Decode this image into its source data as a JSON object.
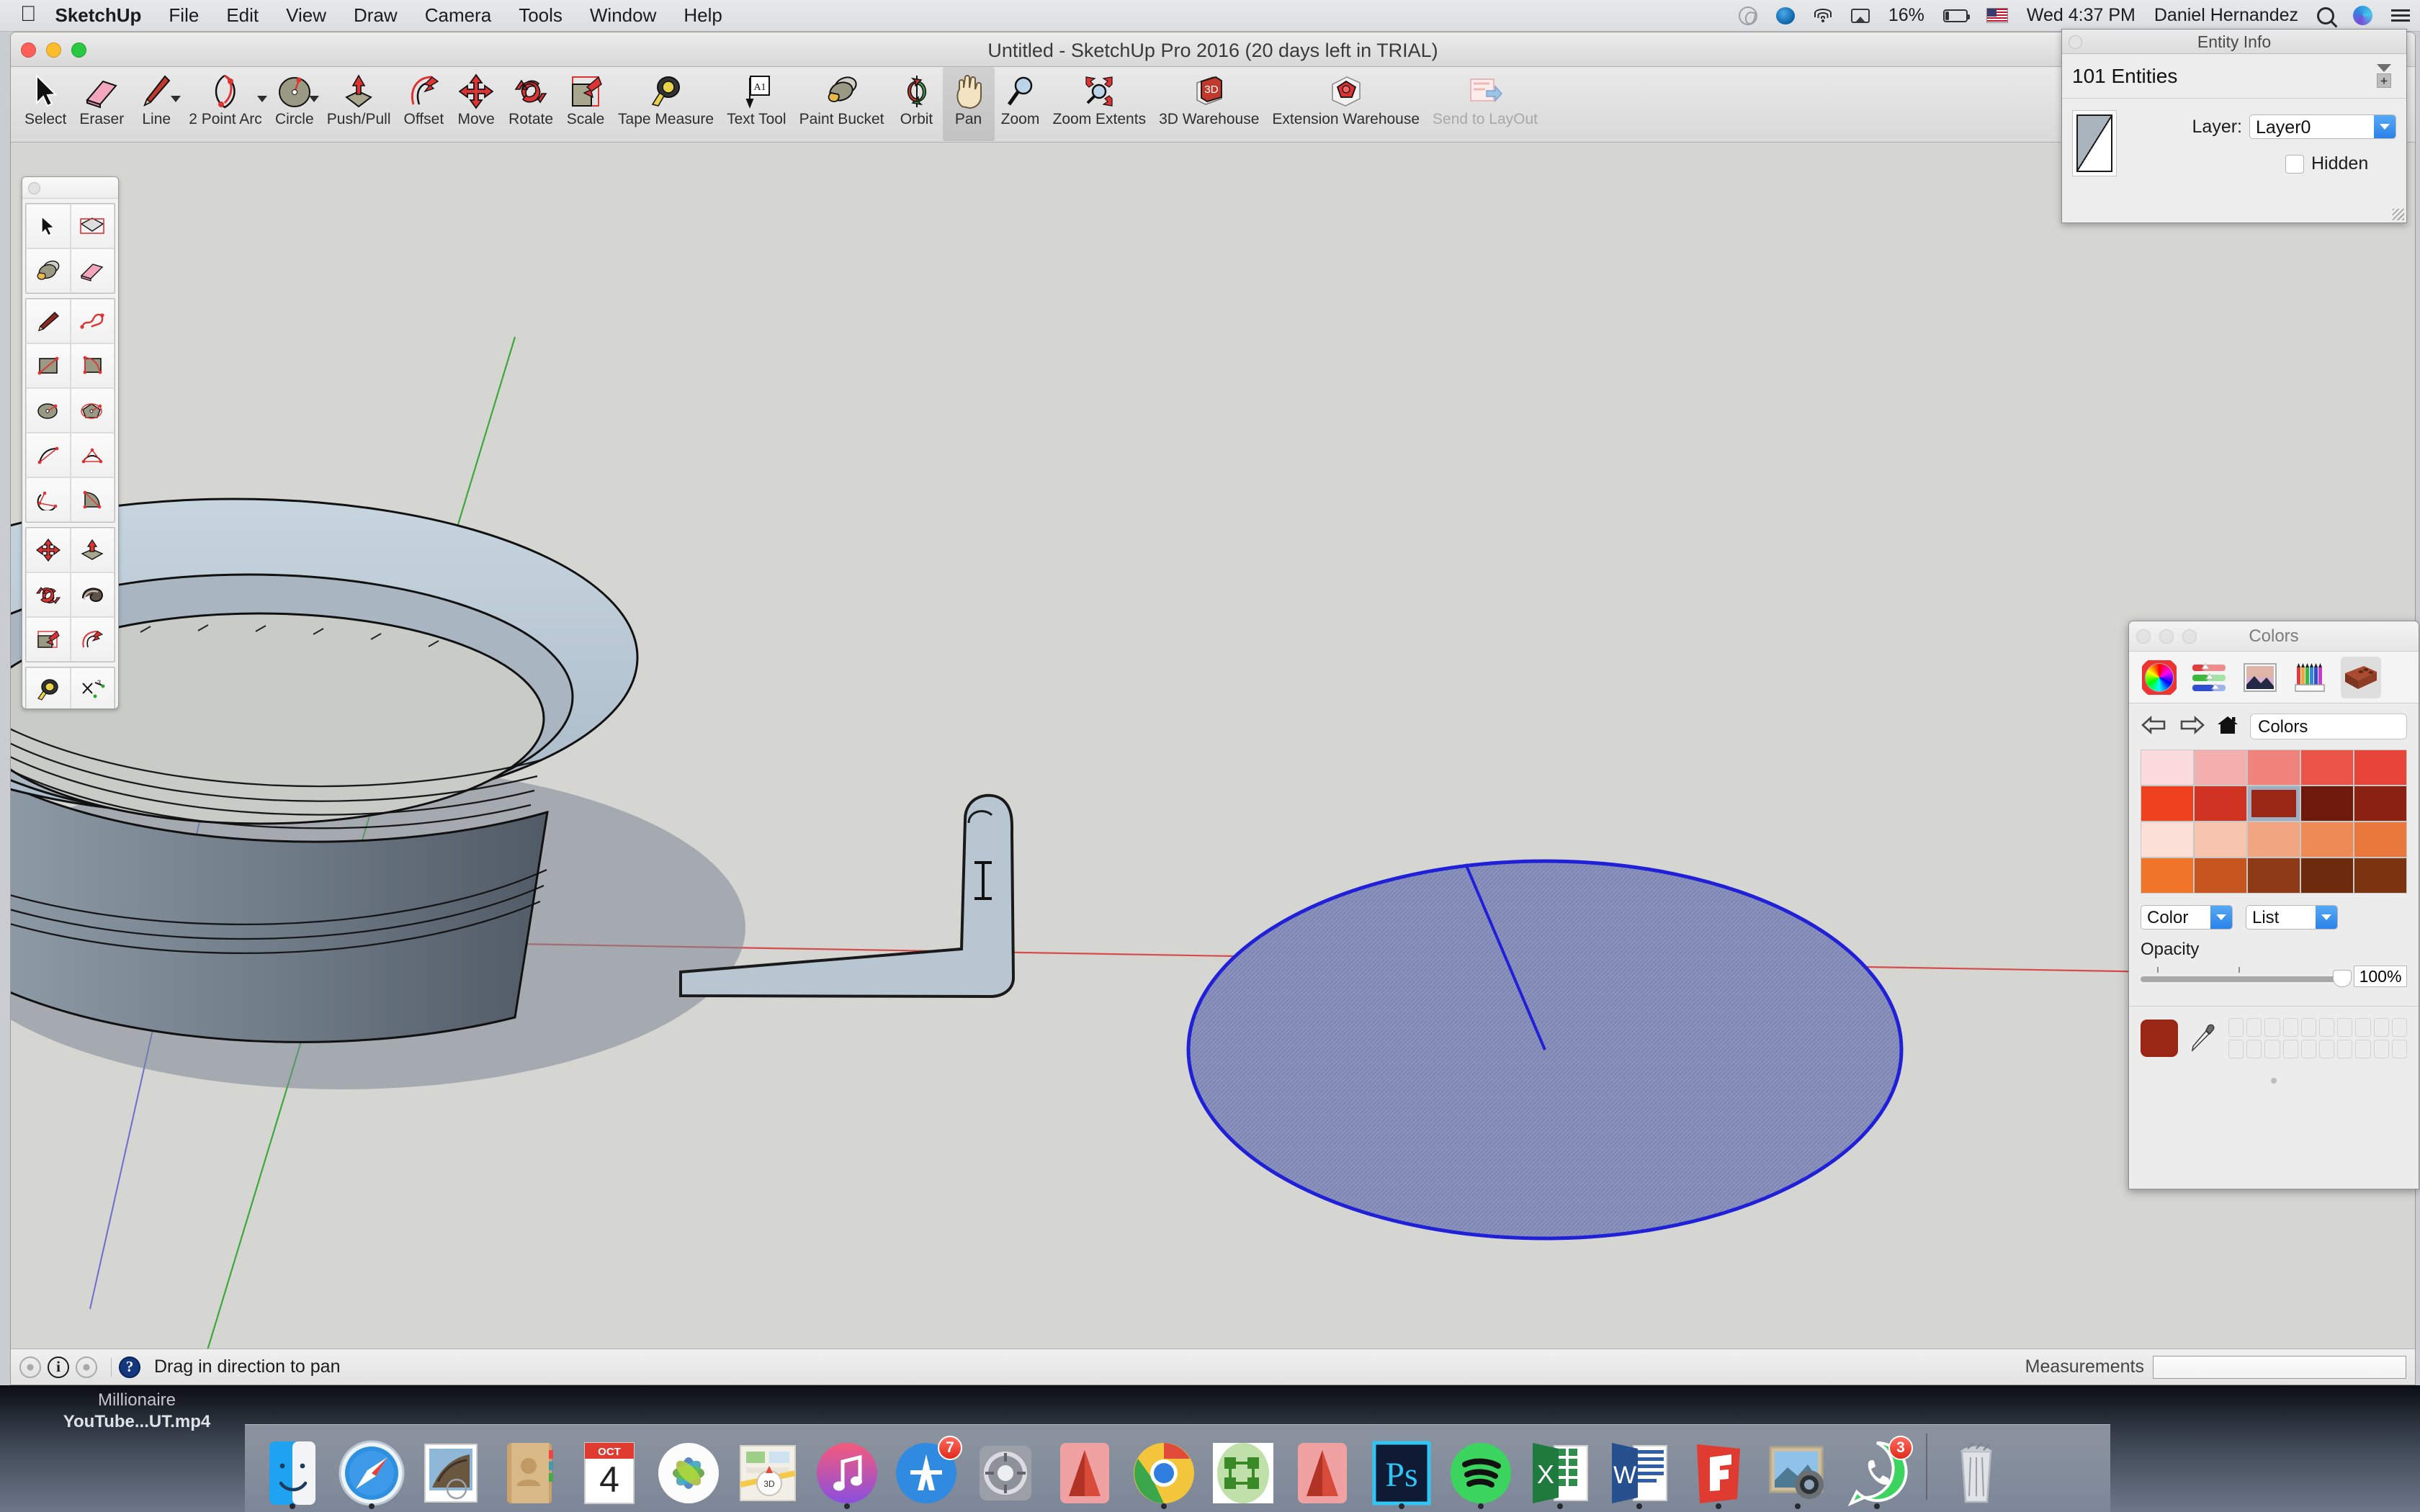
{
  "menubar": {
    "apple_icon": "apple-logo-icon",
    "items": [
      {
        "label": "SketchUp",
        "bold": true
      },
      {
        "label": "File",
        "bold": false
      },
      {
        "label": "Edit",
        "bold": false
      },
      {
        "label": "View",
        "bold": false
      },
      {
        "label": "Draw",
        "bold": false
      },
      {
        "label": "Camera",
        "bold": false
      },
      {
        "label": "Tools",
        "bold": false
      },
      {
        "label": "Window",
        "bold": false
      },
      {
        "label": "Help",
        "bold": false
      }
    ],
    "status": {
      "creative_cloud_icon": "creative-cloud-icon",
      "dropbox_icon": "dropbox-icon",
      "wifi_icon": "wifi-icon",
      "airplay_icon": "airplay-icon",
      "battery_percent": "16%",
      "battery_icon": "battery-icon",
      "flag_icon": "us-flag-icon",
      "clock": "Wed 4:37 PM",
      "user": "Daniel Hernandez",
      "search_icon": "spotlight-search-icon",
      "siri_icon": "siri-icon",
      "notification_icon": "notification-center-icon"
    }
  },
  "window": {
    "title": "Untitled - SketchUp Pro 2016 (20 days left in TRIAL)",
    "close_button": "close-button",
    "minimize_button": "minimize-button",
    "zoom_button": "zoom-button"
  },
  "toolbar": {
    "tools": [
      {
        "label": "Select",
        "icon": "arrow-cursor-icon",
        "active": false,
        "caret": false,
        "disabled": false
      },
      {
        "label": "Eraser",
        "icon": "eraser-icon",
        "active": false,
        "caret": false,
        "disabled": false
      },
      {
        "label": "Line",
        "icon": "pencil-line-icon",
        "active": false,
        "caret": true,
        "disabled": false
      },
      {
        "label": "2 Point Arc",
        "icon": "two-point-arc-icon",
        "active": false,
        "caret": true,
        "disabled": false
      },
      {
        "label": "Circle",
        "icon": "circle-icon",
        "active": false,
        "caret": true,
        "disabled": false
      },
      {
        "label": "Push/Pull",
        "icon": "push-pull-icon",
        "active": false,
        "caret": false,
        "disabled": false
      },
      {
        "label": "Offset",
        "icon": "offset-icon",
        "active": false,
        "caret": false,
        "disabled": false
      },
      {
        "label": "Move",
        "icon": "move-icon",
        "active": false,
        "caret": false,
        "disabled": false
      },
      {
        "label": "Rotate",
        "icon": "rotate-icon",
        "active": false,
        "caret": false,
        "disabled": false
      },
      {
        "label": "Scale",
        "icon": "scale-icon",
        "active": false,
        "caret": false,
        "disabled": false
      },
      {
        "label": "Tape Measure",
        "icon": "tape-measure-icon",
        "active": false,
        "caret": false,
        "disabled": false
      },
      {
        "label": "Text Tool",
        "icon": "text-tool-icon",
        "active": false,
        "caret": false,
        "disabled": false
      },
      {
        "label": "Paint Bucket",
        "icon": "paint-bucket-icon",
        "active": false,
        "caret": false,
        "disabled": false
      },
      {
        "label": "Orbit",
        "icon": "orbit-icon",
        "active": false,
        "caret": false,
        "disabled": false
      },
      {
        "label": "Pan",
        "icon": "pan-hand-icon",
        "active": true,
        "caret": false,
        "disabled": false
      },
      {
        "label": "Zoom",
        "icon": "zoom-magnifier-icon",
        "active": false,
        "caret": false,
        "disabled": false
      },
      {
        "label": "Zoom Extents",
        "icon": "zoom-extents-icon",
        "active": false,
        "caret": false,
        "disabled": false
      },
      {
        "label": "3D Warehouse",
        "icon": "3d-warehouse-icon",
        "active": false,
        "caret": false,
        "disabled": false
      },
      {
        "label": "Extension Warehouse",
        "icon": "extension-warehouse-icon",
        "active": false,
        "caret": false,
        "disabled": false
      },
      {
        "label": "Send to LayOut",
        "icon": "send-to-layout-icon",
        "active": false,
        "caret": false,
        "disabled": true
      }
    ]
  },
  "palette": {
    "groups": [
      {
        "cells": [
          {
            "icon": "select-arrow-icon",
            "active": false
          },
          {
            "icon": "select-box-icon",
            "active": false
          },
          {
            "icon": "paint-bucket-icon",
            "active": false
          },
          {
            "icon": "eraser-icon",
            "active": false
          }
        ]
      },
      {
        "cells": [
          {
            "icon": "line-pencil-icon",
            "active": false
          },
          {
            "icon": "freehand-icon",
            "active": false
          },
          {
            "icon": "rectangle-icon",
            "active": false
          },
          {
            "icon": "rotated-rectangle-icon",
            "active": false
          },
          {
            "icon": "circle-icon",
            "active": false
          },
          {
            "icon": "polygon-icon",
            "active": false
          },
          {
            "icon": "arc-icon",
            "active": false
          },
          {
            "icon": "two-point-arc-icon",
            "active": false
          },
          {
            "icon": "three-point-arc-icon",
            "active": false
          },
          {
            "icon": "pie-icon",
            "active": false
          }
        ]
      },
      {
        "cells": [
          {
            "icon": "move-icon",
            "active": false
          },
          {
            "icon": "push-pull-icon",
            "active": false
          },
          {
            "icon": "rotate-icon",
            "active": false
          },
          {
            "icon": "follow-me-icon",
            "active": false
          },
          {
            "icon": "scale-icon",
            "active": false
          },
          {
            "icon": "offset-icon",
            "active": false
          }
        ]
      },
      {
        "cells": [
          {
            "icon": "tape-measure-icon",
            "active": false
          },
          {
            "icon": "dimension-icon",
            "active": false
          },
          {
            "icon": "protractor-icon",
            "active": false
          },
          {
            "icon": "text-tool-icon",
            "active": false
          },
          {
            "icon": "axes-icon",
            "active": false
          },
          {
            "icon": "3d-text-icon",
            "active": false
          }
        ]
      },
      {
        "cells": [
          {
            "icon": "orbit-icon",
            "active": false
          },
          {
            "icon": "pan-hand-icon",
            "active": true
          },
          {
            "icon": "zoom-magnifier-icon",
            "active": false
          },
          {
            "icon": "zoom-window-icon",
            "active": false
          },
          {
            "icon": "zoom-extents-icon",
            "active": false
          },
          {
            "icon": "previous-view-icon",
            "active": false
          }
        ]
      },
      {
        "cells": [
          {
            "icon": "position-camera-icon",
            "active": false
          },
          {
            "icon": "walk-icon",
            "active": false
          },
          {
            "icon": "look-around-icon",
            "active": false
          },
          {
            "icon": "section-plane-icon",
            "active": false
          }
        ]
      }
    ]
  },
  "entity_info": {
    "panel_title": "Entity Info",
    "count_label": "101 Entities",
    "expand_button": "expand-collapse-button",
    "thumbnail": "face-material-thumbnail",
    "layer_label": "Layer:",
    "layer_value": "Layer0",
    "hidden_label": "Hidden",
    "hidden_checked": false
  },
  "colors_panel": {
    "panel_title": "Colors",
    "tabs": [
      {
        "icon": "color-wheel-icon",
        "active": false
      },
      {
        "icon": "color-sliders-icon",
        "active": false
      },
      {
        "icon": "image-palette-icon",
        "active": false
      },
      {
        "icon": "color-pencils-icon",
        "active": false
      },
      {
        "icon": "brick-materials-icon",
        "active": true
      }
    ],
    "nav": {
      "back_icon": "back-arrow-icon",
      "forward_icon": "forward-arrow-icon",
      "home_icon": "home-icon",
      "path_value": "Colors"
    },
    "swatches": [
      "#fadadb",
      "#f2afae",
      "#f0837c",
      "#ea5548",
      "#f0411f",
      "#d03322",
      "#9a2615",
      "#6d1a0c",
      "#c21e0d",
      "#e8dcd6",
      "#fce0d8",
      "#f7c4ae",
      "#f2a581",
      "#ee8a55",
      "#e9783d",
      "#f07529",
      "#c75520",
      "#8f3a16",
      "#6e2a0d",
      "#dd6a25"
    ],
    "selected_swatch_index": 6,
    "mode_dropdown": "Color",
    "view_dropdown": "List",
    "opacity_label": "Opacity",
    "opacity_value": "100%",
    "current_color": "#9a2615",
    "dropper_icon": "eyedropper-icon"
  },
  "statusbar": {
    "tips_icon": "tips-icon",
    "info_icon": "info-icon",
    "account_icon": "account-icon",
    "help_icon": "help-question-icon",
    "message": "Drag in direction to pan",
    "measurements_label": "Measurements",
    "measurements_value": ""
  },
  "desktop": {
    "caption_line1": "Millionaire",
    "caption_line2": "YouTube...UT.mp4"
  },
  "dock": {
    "items": [
      {
        "name": "Finder",
        "icon": "finder-icon",
        "running": true,
        "badge": null
      },
      {
        "name": "Safari",
        "icon": "safari-icon",
        "running": true,
        "badge": null
      },
      {
        "name": "Mail",
        "icon": "mail-icon",
        "running": false,
        "badge": null
      },
      {
        "name": "Contacts",
        "icon": "contacts-icon",
        "running": false,
        "badge": null
      },
      {
        "name": "Calendar",
        "icon": "calendar-icon",
        "running": false,
        "badge": null,
        "month": "OCT",
        "day": "4"
      },
      {
        "name": "Photos",
        "icon": "photos-icon",
        "running": false,
        "badge": null
      },
      {
        "name": "Maps",
        "icon": "maps-icon",
        "running": false,
        "badge": null
      },
      {
        "name": "iTunes",
        "icon": "itunes-icon",
        "running": true,
        "badge": null
      },
      {
        "name": "App Store",
        "icon": "app-store-icon",
        "running": false,
        "badge": "7"
      },
      {
        "name": "System Preferences",
        "icon": "system-preferences-icon",
        "running": false,
        "badge": null
      },
      {
        "name": "AutoCAD",
        "icon": "autocad-icon",
        "running": false,
        "badge": null
      },
      {
        "name": "Google Chrome",
        "icon": "chrome-icon",
        "running": true,
        "badge": null
      },
      {
        "name": "Sketch",
        "icon": "sketch-green-icon",
        "running": false,
        "badge": null
      },
      {
        "name": "AutoCAD 2",
        "icon": "autocad-red-icon",
        "running": false,
        "badge": null
      },
      {
        "name": "Photoshop",
        "icon": "photoshop-icon",
        "running": true,
        "badge": null
      },
      {
        "name": "Spotify",
        "icon": "spotify-icon",
        "running": true,
        "badge": null
      },
      {
        "name": "Excel",
        "icon": "excel-icon",
        "running": true,
        "badge": null
      },
      {
        "name": "Word",
        "icon": "word-icon",
        "running": true,
        "badge": null
      },
      {
        "name": "SketchUp",
        "icon": "sketchup-icon",
        "running": true,
        "badge": null
      },
      {
        "name": "Preview",
        "icon": "preview-icon",
        "running": true,
        "badge": null
      },
      {
        "name": "WhatsApp",
        "icon": "whatsapp-icon",
        "running": true,
        "badge": "3"
      },
      {
        "name": "Trash",
        "icon": "trash-icon",
        "running": false,
        "badge": null
      }
    ]
  },
  "canvas": {
    "background_color": "#d5d5d2",
    "red_axis_color": "#e04646",
    "green_axis_color": "#3aa83a",
    "blue_axis_color": "#4a4ac8",
    "selected_face_color": "#8e96c4",
    "selection_edge_color": "#2a2ad0",
    "model_face_color": "#b8c6d2"
  }
}
